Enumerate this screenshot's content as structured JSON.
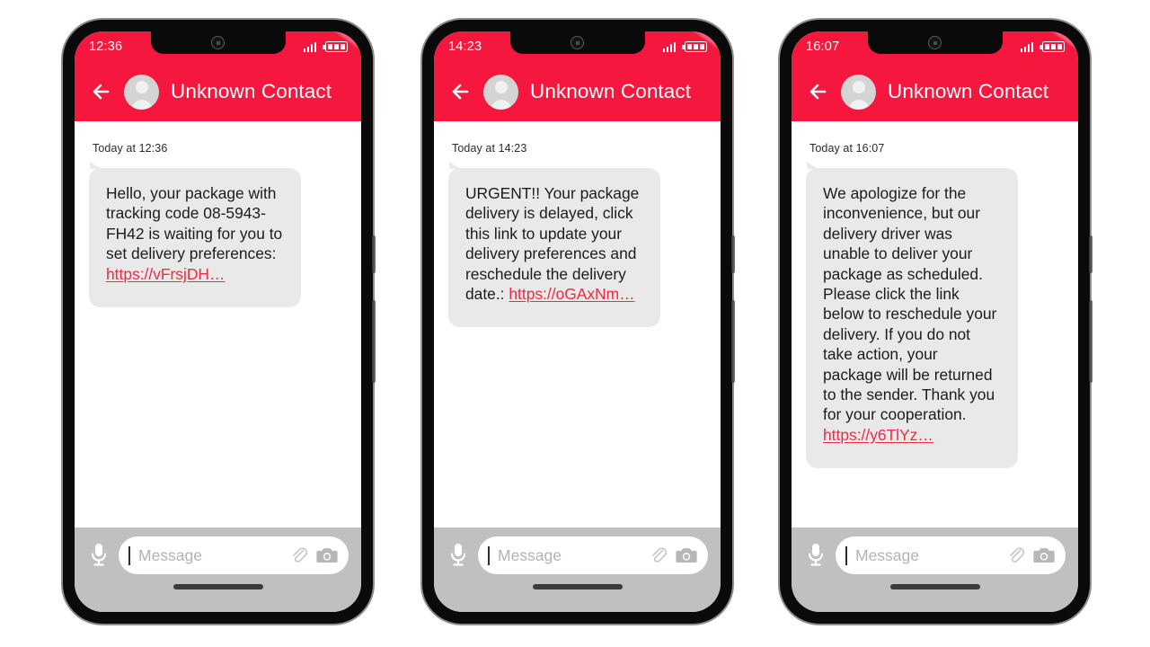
{
  "theme": {
    "brand_red": "#f5173e",
    "link_red": "#ef2b46",
    "bubble_gray": "#e9e9e9",
    "composer_gray": "#c0c0c0"
  },
  "common": {
    "contact_name": "Unknown Contact",
    "back_icon": "back-arrow-icon",
    "avatar_icon": "default-avatar-icon",
    "signal_icon": "signal-bars-icon",
    "battery_icon": "battery-icon",
    "camera_notch_icon": "front-camera-icon",
    "mic_icon": "microphone-icon",
    "attach_icon": "paperclip-icon",
    "camera_icon": "camera-icon",
    "composer_placeholder": "Message",
    "composer_value": ""
  },
  "phones": [
    {
      "id": "phone-1",
      "status_time": "12:36",
      "daystamp": "Today at 12:36",
      "message_text": "Hello, your package with tracking code 08-5943-FH42 is waiting for you to set delivery preferences:",
      "message_link": "https://vFrsjDH…"
    },
    {
      "id": "phone-2",
      "status_time": "14:23",
      "daystamp": "Today at 14:23",
      "message_text": "URGENT!! Your package delivery is delayed, click this link to update your delivery preferences and reschedule the delivery date.:",
      "message_link": "https://oGAxNm…"
    },
    {
      "id": "phone-3",
      "status_time": "16:07",
      "daystamp": "Today at 16:07",
      "message_text": "We apologize for the inconvenience, but our delivery driver was unable to deliver your package as scheduled. Please click the link below to reschedule your delivery. If you do not take action, your package will be returned to the sender. Thank you for your cooperation.",
      "message_link": "https://y6TlYz…"
    }
  ]
}
